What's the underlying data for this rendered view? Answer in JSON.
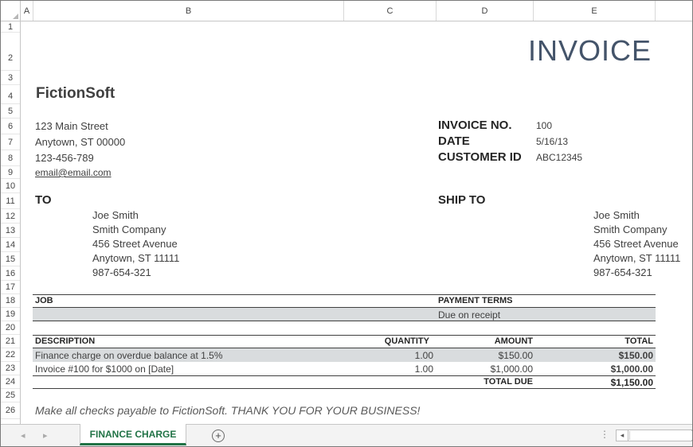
{
  "columns": [
    "A",
    "B",
    "C",
    "D",
    "E"
  ],
  "rows": [
    "1",
    "2",
    "3",
    "4",
    "5",
    "6",
    "7",
    "8",
    "9",
    "10",
    "11",
    "12",
    "13",
    "14",
    "15",
    "16",
    "17",
    "18",
    "19",
    "20",
    "21",
    "22",
    "23",
    "24",
    "25",
    "26"
  ],
  "invoice": {
    "title": "INVOICE",
    "company": "FictionSoft",
    "address": {
      "street": "123 Main Street",
      "city": "Anytown, ST 00000",
      "phone": "123-456-789",
      "email": "email@email.com"
    },
    "meta": {
      "invoice_no_label": "INVOICE NO.",
      "invoice_no": "100",
      "date_label": "DATE",
      "date": "5/16/13",
      "customer_label": "CUSTOMER ID",
      "customer_id": "ABC12345"
    },
    "to": {
      "label": "TO",
      "name": "Joe Smith",
      "company": "Smith Company",
      "street": "456 Street Avenue",
      "city": "Anytown, ST 11111",
      "phone": "987-654-321"
    },
    "ship_to": {
      "label": "SHIP TO",
      "name": "Joe Smith",
      "company": "Smith Company",
      "street": "456 Street Avenue",
      "city": "Anytown, ST 11111",
      "phone": "987-654-321"
    },
    "job": {
      "job_label": "JOB",
      "job_value": "",
      "terms_label": "PAYMENT TERMS",
      "terms_value": "Due on receipt"
    },
    "table": {
      "headers": {
        "description": "DESCRIPTION",
        "quantity": "QUANTITY",
        "amount": "AMOUNT",
        "total": "TOTAL"
      },
      "items": [
        {
          "description": "Finance charge on overdue balance at 1.5%",
          "quantity": "1.00",
          "amount": "$150.00",
          "total": "$150.00"
        },
        {
          "description": "Invoice #100 for $1000 on [Date]",
          "quantity": "1.00",
          "amount": "$1,000.00",
          "total": "$1,000.00"
        }
      ],
      "total_due_label": "TOTAL DUE",
      "total_due": "$1,150.00"
    },
    "footer": "Make all checks payable to FictionSoft. THANK YOU FOR YOUR BUSINESS!"
  },
  "sheet_tabs": {
    "active": "FINANCE CHARGE",
    "add_symbol": "+",
    "prev": "◂",
    "next": "▸",
    "menu_dots": "⋮",
    "scroll_left": "◂"
  },
  "colors": {
    "accent": "#217346",
    "title": "#44546a",
    "shade": "#d9dcde"
  }
}
